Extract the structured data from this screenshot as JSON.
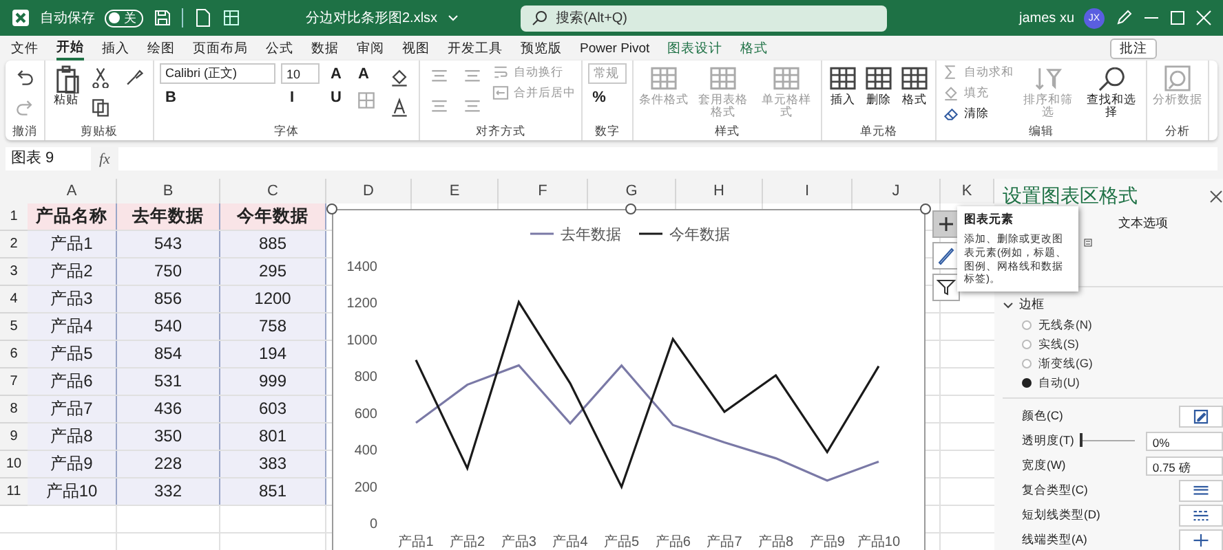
{
  "title_bar": {
    "autosave_label": "自动保存",
    "autosave": {
      "on": false,
      "label": "关"
    },
    "filename": "分边对比条形图2.xlsx",
    "search": {
      "placeholder": "搜索(Alt+Q)"
    },
    "user": "james xu",
    "avatar": "JX"
  },
  "menu_tabs": [
    {
      "label": "文件",
      "selected": false,
      "contextual": false
    },
    {
      "label": "开始",
      "selected": true,
      "contextual": false
    },
    {
      "label": "插入",
      "selected": false,
      "contextual": false
    },
    {
      "label": "绘图",
      "selected": false,
      "contextual": false
    },
    {
      "label": "页面布局",
      "selected": false,
      "contextual": false
    },
    {
      "label": "公式",
      "selected": false,
      "contextual": false
    },
    {
      "label": "数据",
      "selected": false,
      "contextual": false
    },
    {
      "label": "审阅",
      "selected": false,
      "contextual": false
    },
    {
      "label": "视图",
      "selected": false,
      "contextual": false
    },
    {
      "label": "开发工具",
      "selected": false,
      "contextual": false
    },
    {
      "label": "预览版",
      "selected": false,
      "contextual": false
    },
    {
      "label": "Power Pivot",
      "selected": false,
      "contextual": false
    },
    {
      "label": "图表设计",
      "selected": false,
      "contextual": true
    },
    {
      "label": "格式",
      "selected": false,
      "contextual": true
    }
  ],
  "comment_button": "批注",
  "ribbon": [
    {
      "label": "撤消",
      "items": [
        {
          "kind": "tool",
          "disabled": false
        },
        {
          "kind": "tool",
          "disabled": true
        }
      ]
    },
    {
      "label": "剪贴板",
      "items": [
        {
          "kind": "big",
          "label": "粘贴",
          "disabled": false
        },
        {
          "kind": "tool",
          "disabled": false
        },
        {
          "kind": "tool",
          "disabled": false
        },
        {
          "kind": "tool",
          "disabled": false
        }
      ]
    },
    {
      "label": "字体",
      "items": [
        {
          "kind": "field",
          "value": "Calibri (正文)",
          "disabled": false
        },
        {
          "kind": "glyph",
          "label": "B",
          "disabled": false
        },
        {
          "kind": "field",
          "value": "10",
          "disabled": false
        },
        {
          "kind": "glyph",
          "label": "I",
          "disabled": false
        },
        {
          "kind": "glyph",
          "label": "A",
          "disabled": false
        },
        {
          "kind": "glyph",
          "label": "U",
          "disabled": false
        },
        {
          "kind": "glyph",
          "label": "A",
          "disabled": false
        },
        {
          "kind": "tool",
          "disabled": true
        },
        {
          "kind": "tool",
          "disabled": false
        },
        {
          "kind": "tool",
          "disabled": false
        }
      ]
    },
    {
      "label": "对齐方式",
      "items": [
        {
          "kind": "tool",
          "disabled": true
        },
        {
          "kind": "tool",
          "disabled": true
        },
        {
          "kind": "tool",
          "disabled": true
        },
        {
          "kind": "tool",
          "disabled": true
        },
        {
          "kind": "small",
          "label": "自动换行",
          "disabled": true
        },
        {
          "kind": "small",
          "label": "合并后居中",
          "disabled": true
        }
      ]
    },
    {
      "label": "数字",
      "items": [
        {
          "kind": "field",
          "value": "常规",
          "disabled": true
        },
        {
          "kind": "glyph",
          "label": "%",
          "disabled": false
        }
      ]
    },
    {
      "label": "样式",
      "items": [
        {
          "kind": "big",
          "label": "条件格式",
          "disabled": true
        },
        {
          "kind": "big",
          "label": "套用表格格式",
          "disabled": true
        },
        {
          "kind": "big",
          "label": "单元格样式",
          "disabled": true
        }
      ]
    },
    {
      "label": "单元格",
      "items": [
        {
          "kind": "big",
          "label": "插入",
          "disabled": false
        },
        {
          "kind": "big",
          "label": "删除",
          "disabled": false
        },
        {
          "kind": "big",
          "label": "格式",
          "disabled": false
        }
      ]
    },
    {
      "label": "编辑",
      "items": [
        {
          "kind": "small",
          "label": "自动求和",
          "disabled": true
        },
        {
          "kind": "small",
          "label": "填充",
          "disabled": true
        },
        {
          "kind": "small",
          "label": "清除",
          "disabled": false
        },
        {
          "kind": "big",
          "label": "排序和筛选",
          "disabled": true
        },
        {
          "kind": "big",
          "label": "查找和选择",
          "disabled": false
        }
      ]
    },
    {
      "label": "分析",
      "items": [
        {
          "kind": "big",
          "label": "分析数据",
          "disabled": true
        }
      ]
    }
  ],
  "formula_bar": {
    "name_box": "图表 9",
    "fx": "fx"
  },
  "sheet": {
    "columns": [
      "A",
      "B",
      "C",
      "D",
      "E",
      "F",
      "G",
      "H",
      "I",
      "J",
      "K"
    ],
    "rows": [
      {
        "number": "1",
        "cells": [
          "产品名称",
          "去年数据",
          "今年数据"
        ]
      },
      {
        "number": "2",
        "cells": [
          "产品1",
          "543",
          "885"
        ]
      },
      {
        "number": "3",
        "cells": [
          "产品2",
          "750",
          "295"
        ]
      },
      {
        "number": "4",
        "cells": [
          "产品3",
          "856",
          "1200"
        ]
      },
      {
        "number": "5",
        "cells": [
          "产品4",
          "540",
          "758"
        ]
      },
      {
        "number": "6",
        "cells": [
          "产品5",
          "854",
          "194"
        ]
      },
      {
        "number": "7",
        "cells": [
          "产品6",
          "531",
          "999"
        ]
      },
      {
        "number": "8",
        "cells": [
          "产品7",
          "436",
          "603"
        ]
      },
      {
        "number": "9",
        "cells": [
          "产品8",
          "350",
          "801"
        ]
      },
      {
        "number": "10",
        "cells": [
          "产品9",
          "228",
          "383"
        ]
      },
      {
        "number": "11",
        "cells": [
          "产品10",
          "332",
          "851"
        ]
      }
    ]
  },
  "chart": {
    "chart_data": {
      "type": "line",
      "categories": [
        "产品1",
        "产品2",
        "产品3",
        "产品4",
        "产品5",
        "产品6",
        "产品7",
        "产品8",
        "产品9",
        "产品10"
      ],
      "series": [
        {
          "name": "去年数据",
          "color": "#7a79a6",
          "values": [
            543,
            750,
            856,
            540,
            854,
            531,
            436,
            350,
            228,
            332
          ]
        },
        {
          "name": "今年数据",
          "color": "#1a1a1a",
          "values": [
            885,
            295,
            1200,
            758,
            194,
            999,
            603,
            801,
            383,
            851
          ]
        }
      ],
      "ylim": [
        0,
        1400
      ],
      "yticks": [
        {
          "value": 0,
          "label": "0"
        },
        {
          "value": 200,
          "label": "200"
        },
        {
          "value": 400,
          "label": "400"
        },
        {
          "value": 600,
          "label": "600"
        },
        {
          "value": 800,
          "label": "800"
        },
        {
          "value": 1000,
          "label": "1000"
        },
        {
          "value": 1200,
          "label": "1200"
        },
        {
          "value": 1400,
          "label": "1400"
        }
      ],
      "legend": "top"
    }
  },
  "tooltip": {
    "title": "图表元素",
    "text": "添加、删除或更改图表元素(例如，标题、图例、网格线和数据标签)。"
  },
  "pane": {
    "title": "设置图表区格式",
    "text_options_tab": "文本选项",
    "section": {
      "label": "边框",
      "expanded": true,
      "options": [
        {
          "label": "无线条(N)",
          "selected": false
        },
        {
          "label": "实线(S)",
          "selected": false
        },
        {
          "label": "渐变线(G)",
          "selected": false
        },
        {
          "label": "自动(U)",
          "selected": true
        }
      ],
      "properties": [
        {
          "kind": "picker",
          "label": "颜色(C)"
        },
        {
          "kind": "slider",
          "label": "透明度(T)",
          "value": "0%",
          "level": 0
        },
        {
          "kind": "spin",
          "label": "宽度(W)",
          "value": "0.75 磅"
        },
        {
          "kind": "picker",
          "label": "复合类型(C)"
        },
        {
          "kind": "picker",
          "label": "短划线类型(D)"
        },
        {
          "kind": "picker",
          "label": "线端类型(A)"
        }
      ]
    }
  }
}
